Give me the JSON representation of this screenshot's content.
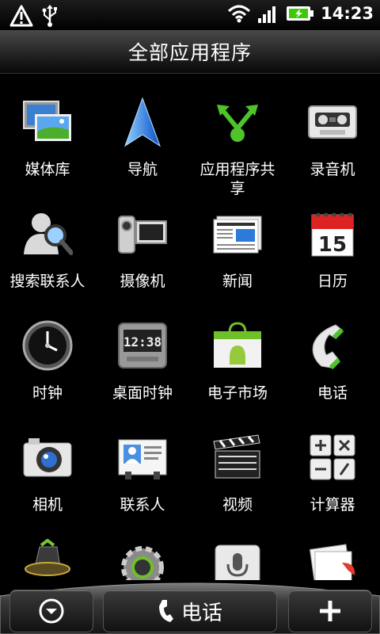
{
  "status_bar": {
    "time": "14:23",
    "icons": [
      "warning-icon",
      "usb-icon",
      "wifi-icon",
      "signal-icon",
      "battery-charging-icon"
    ]
  },
  "title": "全部应用程序",
  "apps": [
    {
      "label": "媒体库",
      "icon": "gallery-icon"
    },
    {
      "label": "导航",
      "icon": "navigation-icon"
    },
    {
      "label": "应用程序共享",
      "label_line1": "应用程序共",
      "label_line2": "享",
      "icon": "app-sharing-icon"
    },
    {
      "label": "录音机",
      "icon": "voice-recorder-icon"
    },
    {
      "label": "搜索联系人",
      "icon": "search-contacts-icon"
    },
    {
      "label": "摄像机",
      "icon": "camcorder-icon"
    },
    {
      "label": "新闻",
      "icon": "news-icon"
    },
    {
      "label": "日历",
      "icon": "calendar-icon",
      "day": "15"
    },
    {
      "label": "时钟",
      "icon": "clock-icon"
    },
    {
      "label": "桌面时钟",
      "icon": "desk-clock-icon",
      "digits": "12:38"
    },
    {
      "label": "电子市场",
      "icon": "market-icon"
    },
    {
      "label": "电话",
      "icon": "phone-icon"
    },
    {
      "label": "相机",
      "icon": "camera-icon"
    },
    {
      "label": "联系人",
      "icon": "contacts-icon"
    },
    {
      "label": "视频",
      "icon": "video-icon"
    },
    {
      "label": "计算器",
      "icon": "calculator-icon"
    },
    {
      "label": "",
      "icon": "hat-app-icon"
    },
    {
      "label": "",
      "icon": "settings-gear-icon"
    },
    {
      "label": "",
      "icon": "microphone-icon"
    },
    {
      "label": "",
      "icon": "mail-icon"
    }
  ],
  "dock": {
    "phone_label": "电话",
    "left_icon": "collapse-down-icon",
    "right_icon": "add-icon"
  }
}
